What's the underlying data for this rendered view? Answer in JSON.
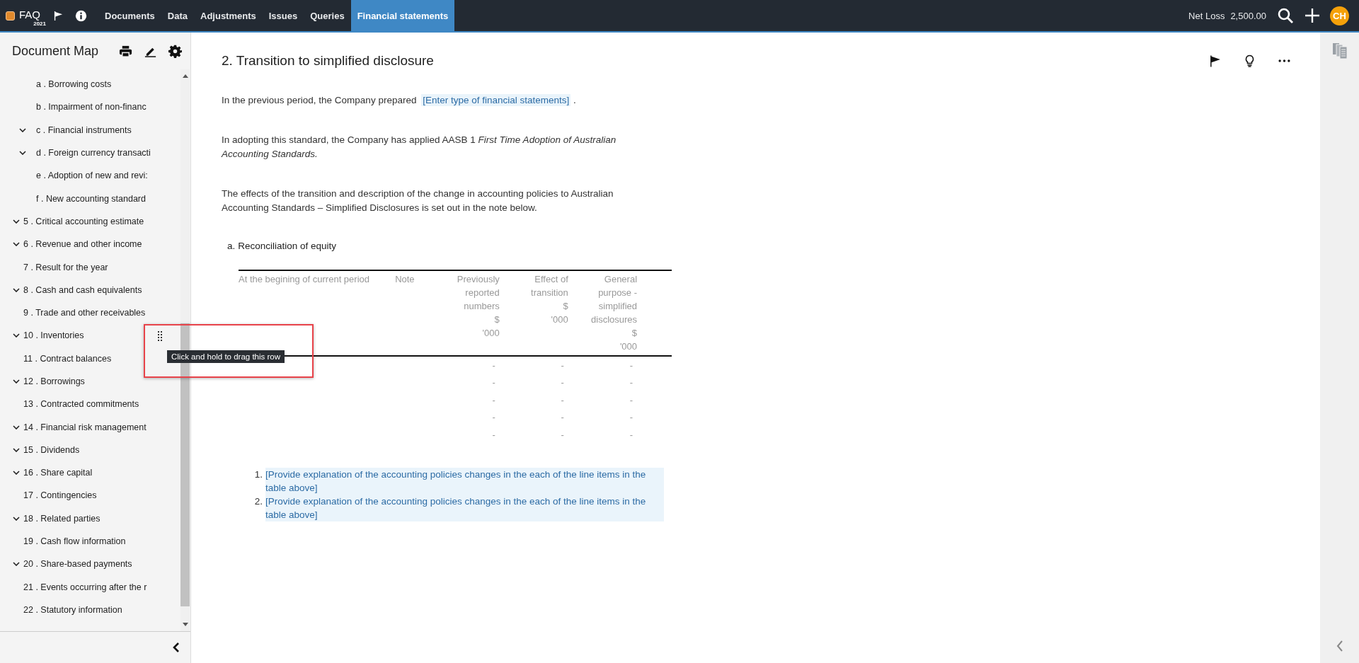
{
  "topbar": {
    "logo": "FAQ",
    "year": "2021",
    "tabs": [
      {
        "label": "Documents",
        "selected": false
      },
      {
        "label": "Data",
        "selected": false
      },
      {
        "label": "Adjustments",
        "selected": false
      },
      {
        "label": "Issues",
        "selected": false
      },
      {
        "label": "Queries",
        "selected": false
      },
      {
        "label": "Financial statements",
        "selected": true
      }
    ],
    "net_label": "Net Loss",
    "net_value": "2,500.00",
    "avatar": "CH"
  },
  "sidebar": {
    "title": "Document Map",
    "items": [
      {
        "children": [
          {
            "label": "a . Borrowing costs",
            "expandable": false
          },
          {
            "label": "b . Impairment of non-financ",
            "expandable": false
          },
          {
            "label": "c . Financial instruments",
            "expandable": true
          },
          {
            "label": "d . Foreign currency transacti",
            "expandable": true
          },
          {
            "label": "e . Adoption of new and revi:",
            "expandable": false
          },
          {
            "label": "f . New accounting standard",
            "expandable": false
          }
        ]
      },
      {
        "label": "5 . Critical accounting estimate",
        "expandable": true
      },
      {
        "label": "6 . Revenue and other income",
        "expandable": true
      },
      {
        "label": "7 . Result for the year",
        "expandable": false
      },
      {
        "label": "8 . Cash and cash equivalents",
        "expandable": true
      },
      {
        "label": "9 . Trade and other receivables",
        "expandable": false
      },
      {
        "label": "10 . Inventories",
        "expandable": true
      },
      {
        "label": "11 . Contract balances",
        "expandable": false
      },
      {
        "label": "12 . Borrowings",
        "expandable": true
      },
      {
        "label": "13 . Contracted commitments",
        "expandable": false
      },
      {
        "label": "14 . Financial risk management",
        "expandable": true
      },
      {
        "label": "15 . Dividends",
        "expandable": true
      },
      {
        "label": "16 . Share capital",
        "expandable": true
      },
      {
        "label": "17 . Contingencies",
        "expandable": false
      },
      {
        "label": "18 . Related parties",
        "expandable": true
      },
      {
        "label": "19 . Cash flow information",
        "expandable": false
      },
      {
        "label": "20 . Share-based payments",
        "expandable": true
      },
      {
        "label": "21 . Events occurring after the r",
        "expandable": false
      },
      {
        "label": "22 . Statutory information",
        "expandable": false
      }
    ],
    "tooltip": "Click and hold to drag this row"
  },
  "document": {
    "title": "2. Transition to simplified disclosure",
    "paragraphs": [
      [
        {
          "kind": "text",
          "text": "In the previous period, the Company prepared "
        },
        {
          "kind": "field",
          "text": "[Enter type of financial statements]"
        },
        {
          "kind": "text",
          "text": " ."
        }
      ],
      [
        {
          "kind": "text",
          "text": "In adopting this standard, the Company has applied AASB 1 *First Time Adoption of Australian Accounting Standards.*"
        }
      ],
      [
        {
          "kind": "text",
          "text": "The effects of the transition and description of the change in accounting policies to Australian Accounting Standards – Simplified Disclosures is set out in the note below."
        }
      ]
    ],
    "section": {
      "label": "a.",
      "title": "Reconciliation of equity"
    },
    "table": {
      "columns": [
        "At the begining of current period",
        "Note",
        "Previously\nreported\nnumbers\n$\n'000",
        "Effect of\ntransition\n$\n'000",
        "General\npurpose -\nsimplified\ndisclosures\n$\n'000"
      ],
      "rows": [
        {
          "values": [
            "-",
            "-",
            "-"
          ]
        },
        {
          "values": [
            "-",
            "-",
            "-"
          ]
        },
        {
          "values": [
            "-",
            "-",
            "-"
          ]
        },
        {
          "values": [
            "-",
            "-",
            "-"
          ]
        },
        {
          "values": [
            "-",
            "-",
            "-"
          ]
        }
      ]
    },
    "notes": [
      {
        "number": "1.",
        "text": "[Provide explanation of the accounting policies changes in the each of the line items in the table above]"
      },
      {
        "number": "2.",
        "text": "[Provide explanation of the accounting policies changes in the each of the line items in the table above]"
      }
    ]
  }
}
